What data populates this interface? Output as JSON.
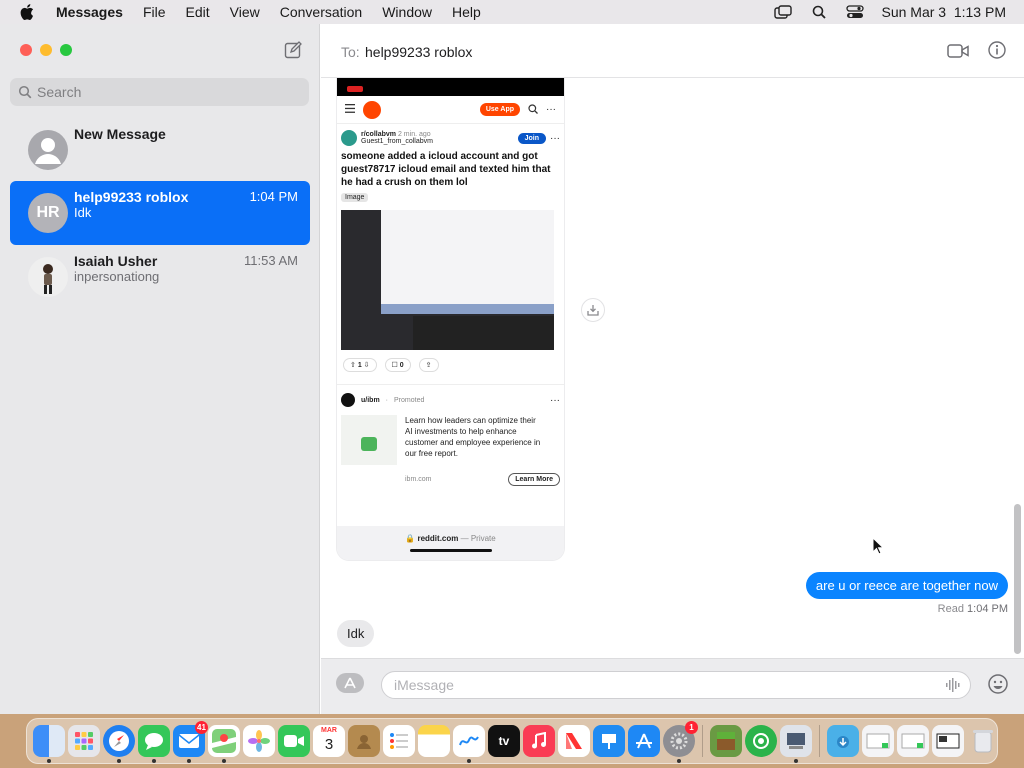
{
  "menubar": {
    "app_name": "Messages",
    "menus": [
      "File",
      "Edit",
      "View",
      "Conversation",
      "Window",
      "Help"
    ],
    "clock": "Sun Mar 3  1:13 PM"
  },
  "sidebar": {
    "search_placeholder": "Search",
    "conversations": [
      {
        "name": "New Message",
        "preview": "",
        "time": "",
        "initials": ""
      },
      {
        "name": "help99233 roblox",
        "preview": "Idk",
        "time": "1:04 PM",
        "initials": "HR"
      },
      {
        "name": "Isaiah Usher",
        "preview": "inpersonationg",
        "time": "11:53 AM",
        "initials": ""
      }
    ]
  },
  "chat": {
    "to_label": "To:",
    "recipient": "help99233 roblox",
    "attachment": {
      "use_app": "Use App",
      "subreddit": "r/collabvm",
      "posted_ago": "2 min. ago",
      "author": "Guest1_from_collabvm",
      "join": "Join",
      "post_title": "someone added a icloud account and got guest78717 icloud email and texted him that he had a crush on them lol",
      "tag": "Image",
      "upvotes": "1",
      "comments": "0",
      "promo_account": "u/ibm",
      "promo_label": "Promoted",
      "promo_text": "Learn how leaders can optimize their AI investments to help enhance customer and employee experience in our free report.",
      "promo_domain": "ibm.com",
      "learn_more": "Learn More",
      "url": "reddit.com",
      "url_suffix": "— Private"
    },
    "outgoing": "are u or reece are together now",
    "read_label": "Read",
    "read_time": "1:04 PM",
    "incoming": "Idk",
    "input_placeholder": "iMessage"
  },
  "dock": {
    "calendar_month": "MAR",
    "calendar_day": "3",
    "mail_badge": "41",
    "settings_badge": "1",
    "tv_label": "tv"
  },
  "colors": {
    "accent": "#0a84ff",
    "selection": "#0a6ff7",
    "reddit": "#ff4500"
  }
}
